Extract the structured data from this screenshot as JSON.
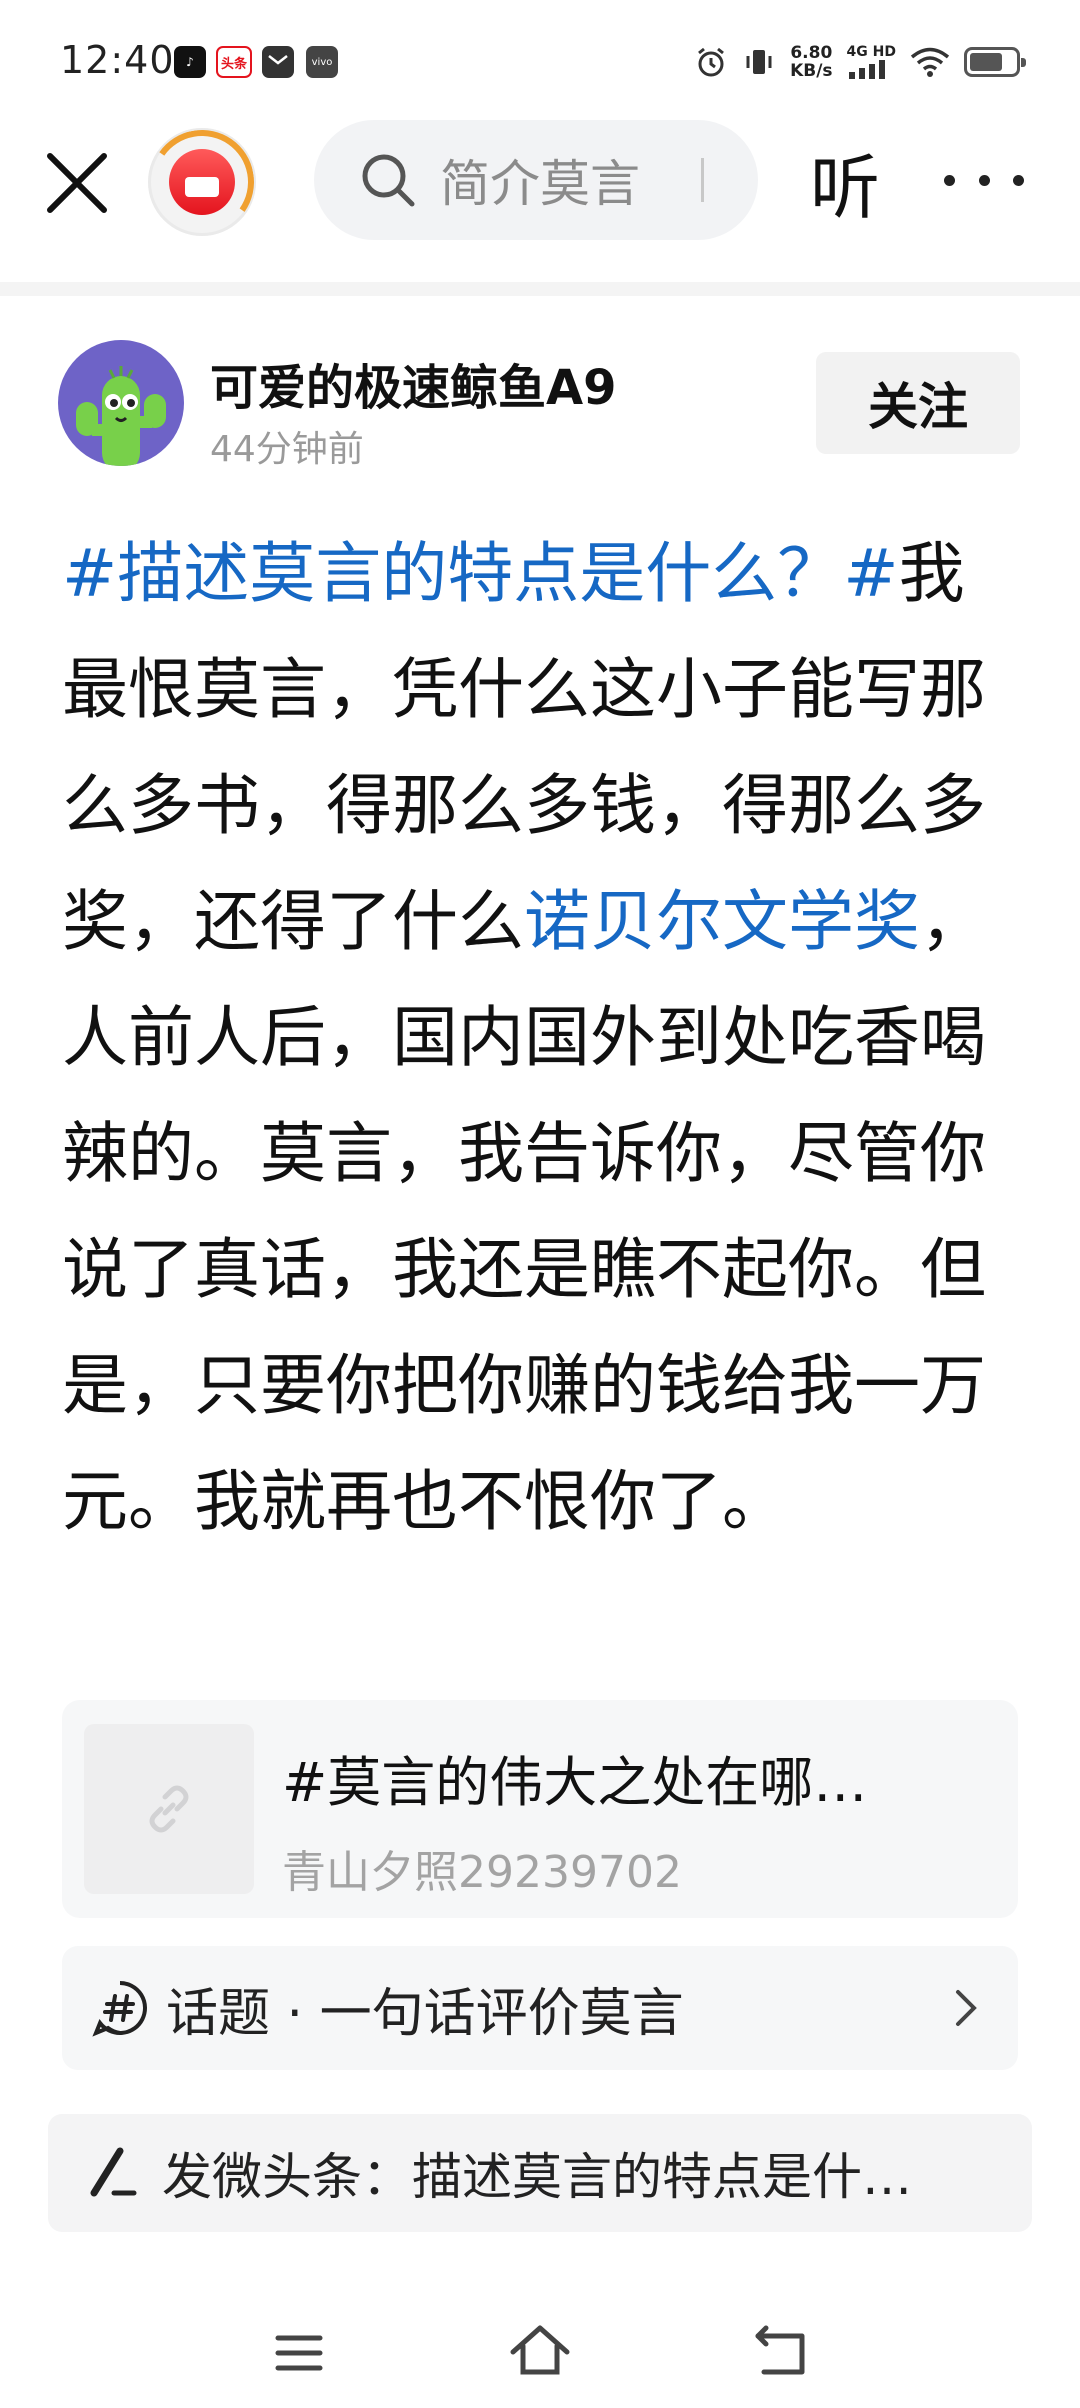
{
  "status_bar": {
    "time": "12:40",
    "net_speed_value": "6.80",
    "net_speed_unit": "KB/s",
    "net_type": "4G HD",
    "battery_level": 0.75,
    "notification_icons": [
      "douyin-icon",
      "toutiao-icon",
      "message-icon",
      "vivo-icon"
    ],
    "toutiao_label": "头条",
    "vivo_label": "vivo"
  },
  "top_nav": {
    "search_placeholder": "简介莫言",
    "listen_label": "听"
  },
  "author": {
    "name": "可爱的极速鲸鱼A9",
    "time": "44分钟前",
    "follow_label": "关注"
  },
  "post": {
    "hashtag": "#描述莫言的特点是什么？#",
    "text_1": "我最恨莫言，凭什么这小子能写那么多书，得那么多钱，得那么多奖，还得了什么",
    "link_text": "诺贝尔文学奖",
    "text_2": "，人前人后，国内国外到处吃香喝辣的。莫言，我告诉你，尽管你说了真话，我还是瞧不起你。但是，只要你把你赚的钱给我一万元。我就再也不恨你了。"
  },
  "quote_card": {
    "title": "#莫言的伟大之处在哪…",
    "author": "青山夕照29239702"
  },
  "topic": {
    "label": "话题 · 一句话评价莫言"
  },
  "compose": {
    "label": "发微头条：描述莫言的特点是什…"
  },
  "colors": {
    "link": "#1668c4",
    "toutiao_red": "#e4141e",
    "avatar_bg": "#6e63c7"
  }
}
